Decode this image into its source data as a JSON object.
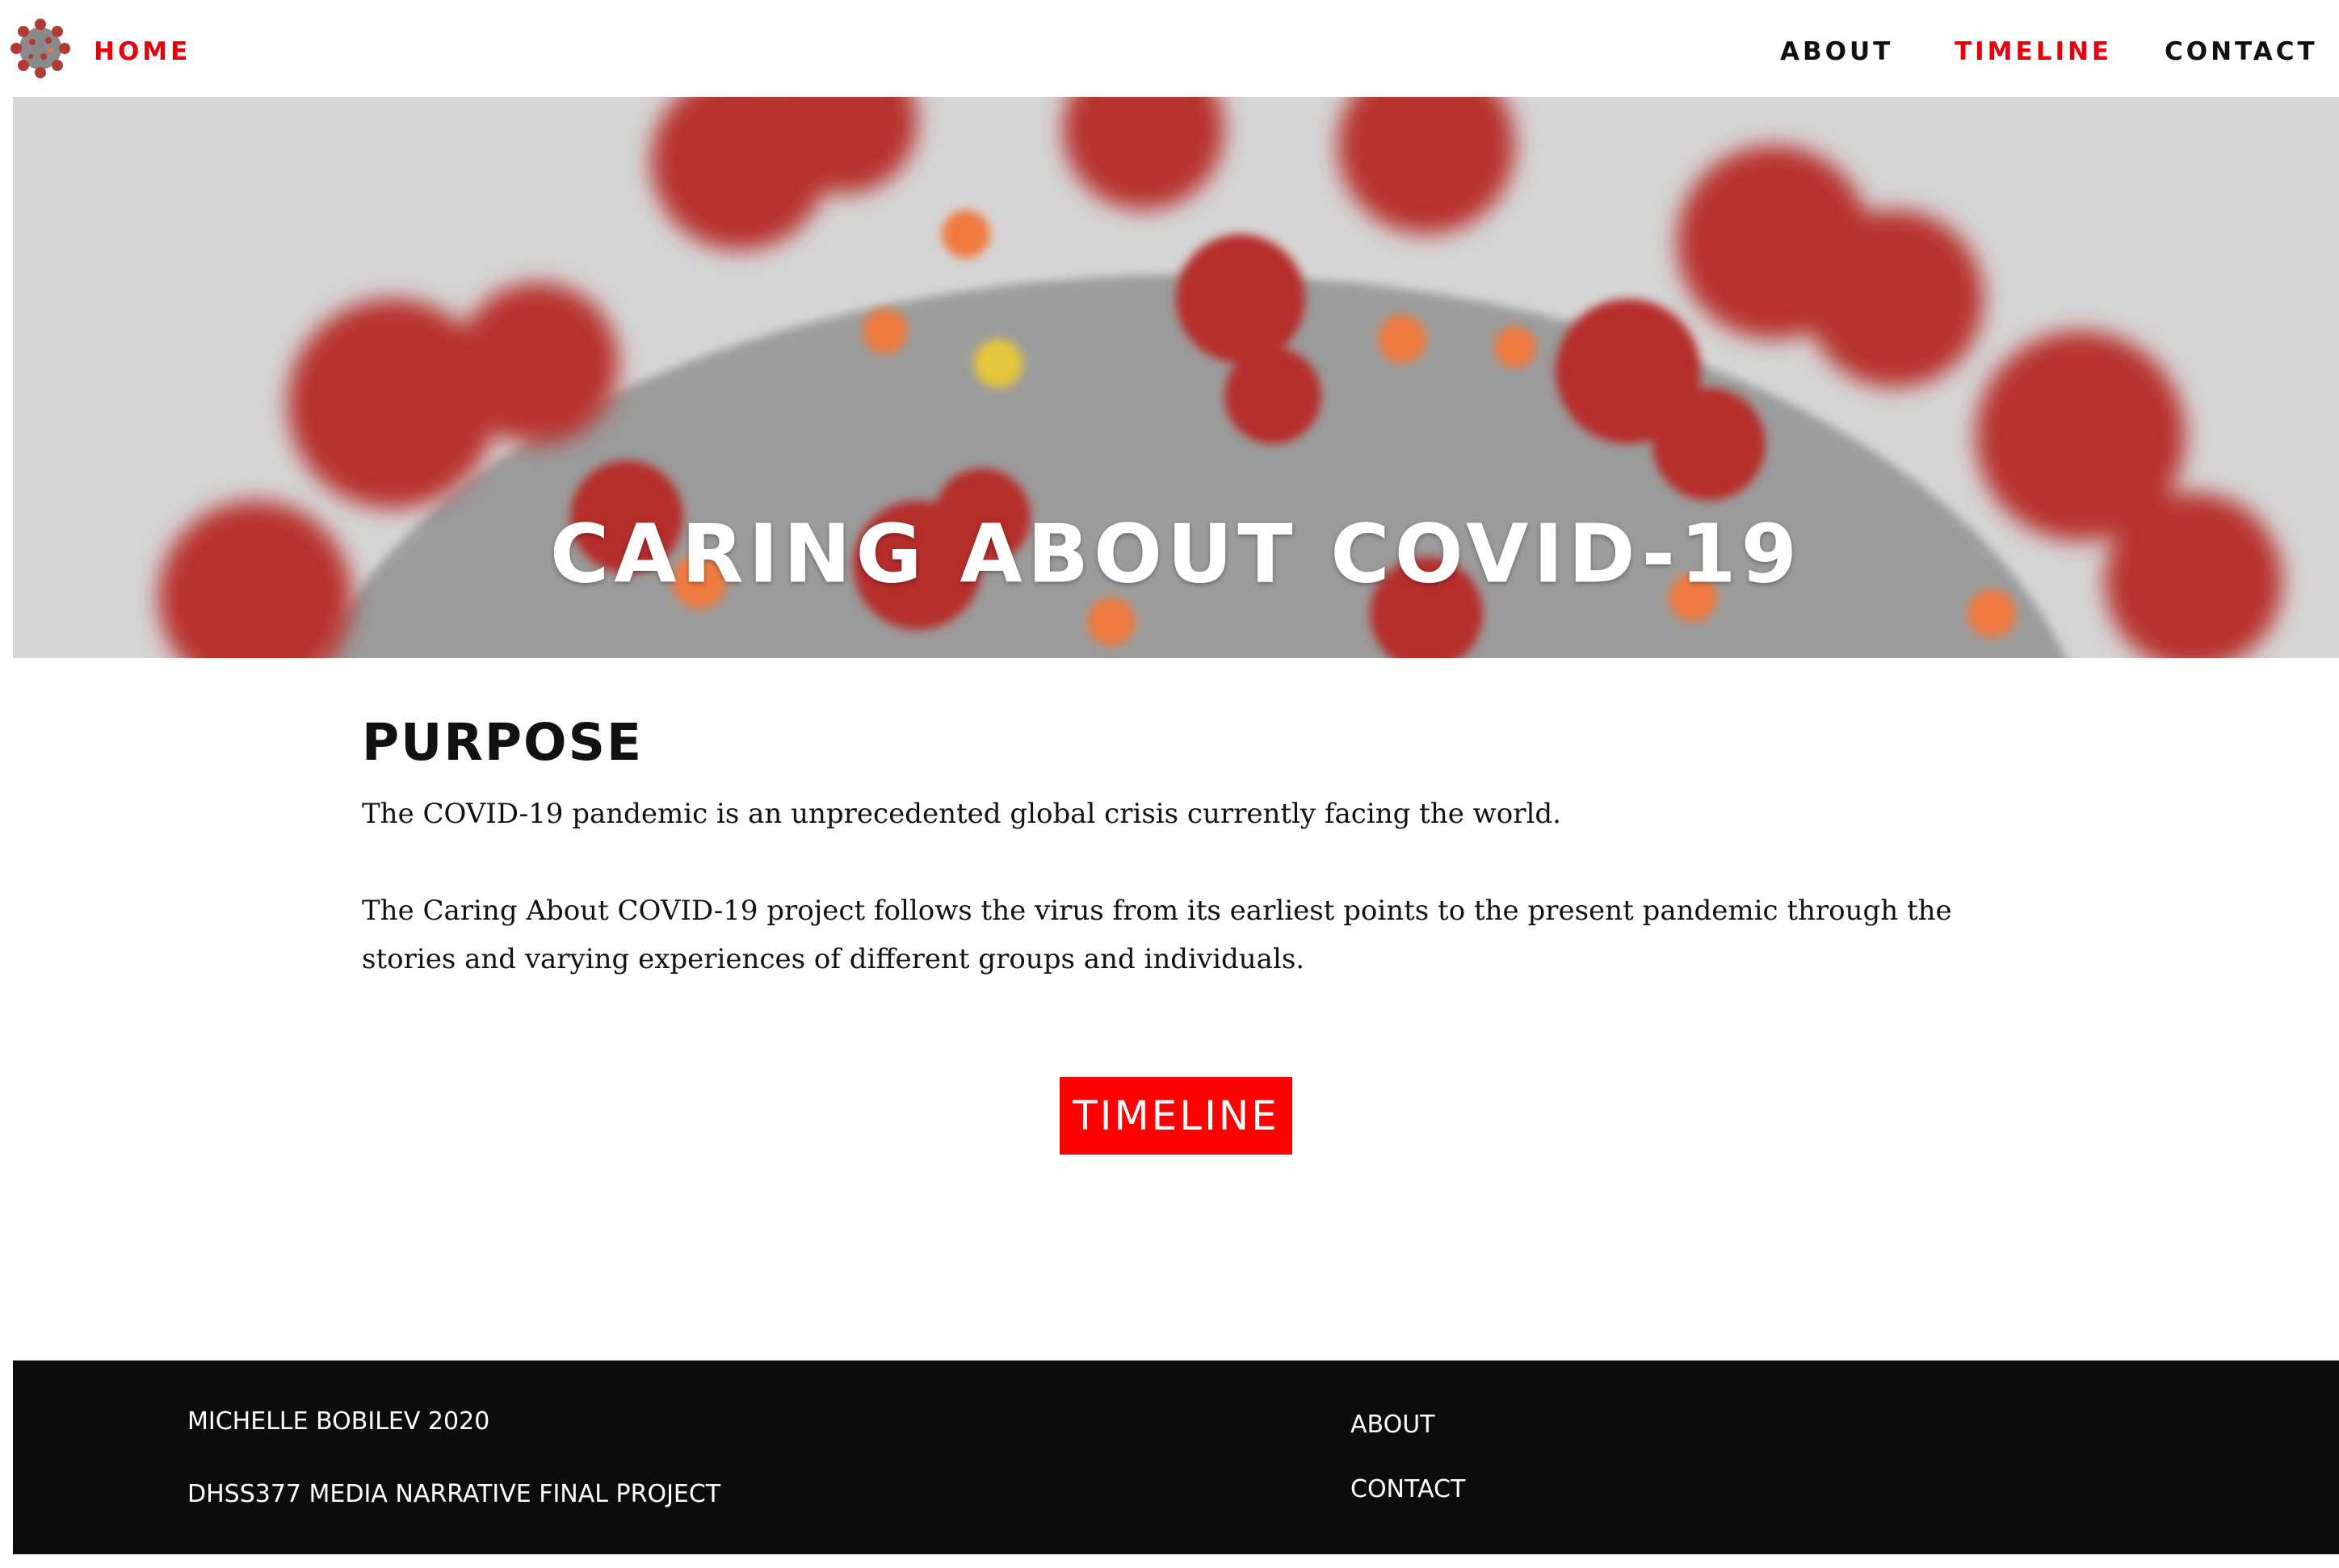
{
  "colors": {
    "accent": "#e8000b",
    "nav_text": "#111111",
    "button_bg": "#ff0000",
    "footer_bg": "#0c0c0c",
    "spike_red": "#b8322e",
    "spike_orange": "#f07a3f",
    "virus_gray": "#8f8f8f"
  },
  "nav": {
    "logo_icon": "virus-logo-icon",
    "home_label": "HOME",
    "items": [
      {
        "label": "ABOUT",
        "active": false
      },
      {
        "label": "TIMELINE",
        "active": true
      },
      {
        "label": "CONTACT",
        "active": false
      }
    ]
  },
  "hero": {
    "title": "CARING ABOUT COVID-19"
  },
  "content": {
    "heading": "PURPOSE",
    "paragraph1": "The COVID-19 pandemic is an unprecedented global crisis currently facing the world.",
    "paragraph2": "The Caring About COVID-19 project follows the virus from its earliest points to the present pandemic through the stories and varying experiences of different groups and individuals.",
    "button_label": "TIMELINE"
  },
  "footer": {
    "copyright": "MICHELLE BOBILEV 2020",
    "project": "DHSS377 MEDIA NARRATIVE FINAL PROJECT",
    "links": [
      "ABOUT",
      "CONTACT"
    ]
  }
}
